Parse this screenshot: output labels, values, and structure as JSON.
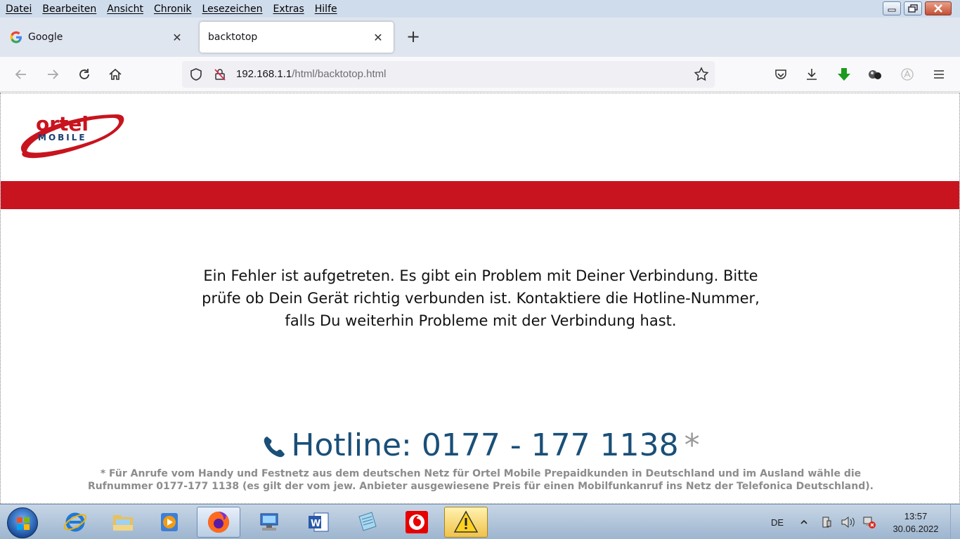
{
  "menubar": {
    "items": [
      "Datei",
      "Bearbeiten",
      "Ansicht",
      "Chronik",
      "Lesezeichen",
      "Extras",
      "Hilfe"
    ]
  },
  "tabs": [
    {
      "title": "Google",
      "icon": "google-icon",
      "active": false
    },
    {
      "title": "backtotop",
      "icon": "none",
      "active": true
    }
  ],
  "urlbar": {
    "host": "192.168.1.1",
    "path": "/html/backtotop.html"
  },
  "page": {
    "logo_top": "ortel",
    "logo_bottom": "MOBILE",
    "brand_color": "#c8141e",
    "error_message": "Ein Fehler ist aufgetreten. Es gibt ein Problem mit Deiner Verbindung. Bitte prüfe ob Dein Gerät richtig verbunden ist. Kontaktiere die Hotline-Nummer, falls Du weiterhin Probleme mit der Verbindung hast.",
    "hotline_text": "Hotline: 0177 - 177 1138",
    "hotline_asterisk": "*",
    "hotline_color": "#1a4f78",
    "footnote": "* Für Anrufe vom Handy und Festnetz aus dem deutschen Netz für Ortel Mobile Prepaidkunden in Deutschland und im Ausland wähle die Rufnummer 0177-177 1138 (es gilt der vom jew. Anbieter ausgewiesene Preis für einen Mobilfunkanruf ins Netz der Telefonica Deutschland)."
  },
  "taskbar": {
    "apps": [
      "internet-explorer",
      "explorer",
      "media-player",
      "firefox",
      "remote-desktop",
      "word",
      "notepad",
      "vodafone",
      "warning"
    ],
    "language": "DE",
    "time": "13:57",
    "date": "30.06.2022"
  }
}
